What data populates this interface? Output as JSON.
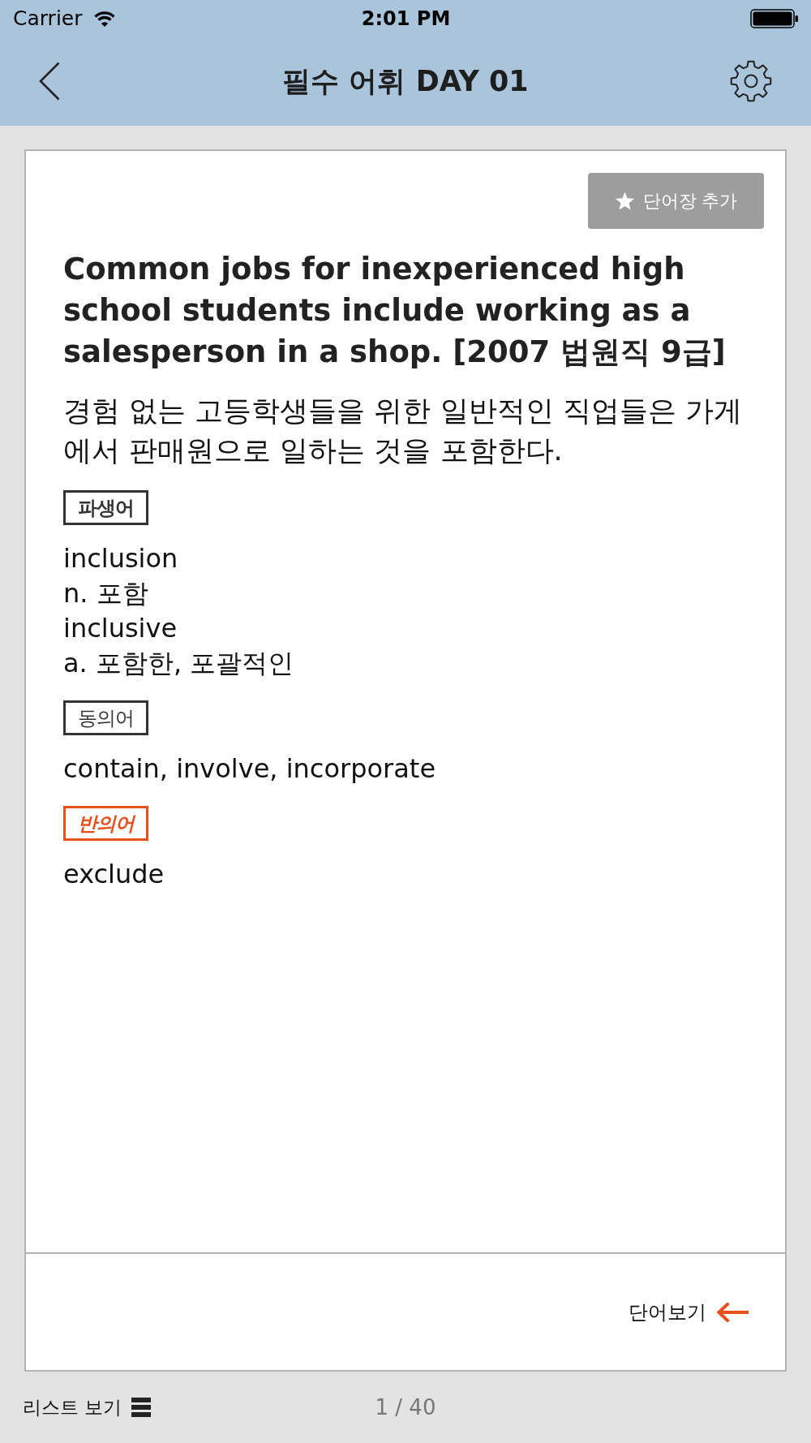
{
  "status_bar": {
    "carrier": "Carrier",
    "time": "2:01 PM"
  },
  "nav_bar": {
    "title": "필수 어휘 DAY 01"
  },
  "card": {
    "add_button": {
      "label": "단어장 추가"
    },
    "sentence": "Common jobs for inexperienced high school students include working as a salesperson in a shop. [2007 법원직 9급]",
    "translation": "경험 없는 고등학생들을 위한 일반적인 직업들은 가게에서 판매원으로 일하는 것을 포함한다.",
    "sections": [
      {
        "label": "파생어",
        "kind": "derivative",
        "color": "#333333",
        "lines": [
          "inclusion",
          "n. 포함",
          "inclusive",
          "a. 포함한, 포괄적인"
        ]
      },
      {
        "label": "동의어",
        "kind": "synonym",
        "color": "#333333",
        "lines": [
          "contain, involve, incorporate"
        ]
      },
      {
        "label": "반의어",
        "kind": "antonym",
        "color": "#e8501e",
        "lines": [
          "exclude"
        ]
      }
    ],
    "footer_link": {
      "label": "단어보기"
    }
  },
  "bottom_bar": {
    "list_view": "리스트 보기",
    "page": "1 / 40"
  }
}
